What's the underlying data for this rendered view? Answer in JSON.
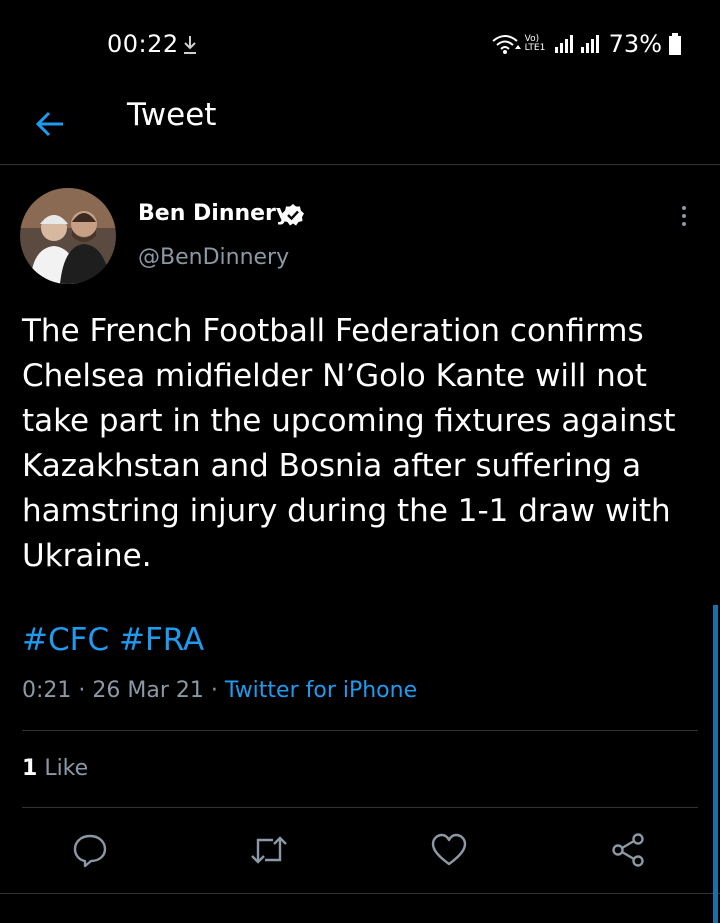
{
  "status_bar": {
    "time": "00:22",
    "network_label_top": "Vo)",
    "network_label_bottom": "LTE1",
    "battery": "73%",
    "icons": [
      "download-icon",
      "wifi-icon",
      "signal-icon",
      "signal-icon",
      "battery-icon"
    ]
  },
  "header": {
    "title": "Tweet",
    "back_icon": "arrow-left-icon"
  },
  "tweet": {
    "author_name": "Ben Dinnery",
    "author_handle": "@BenDinnery",
    "verified": true,
    "text": "The French Football Federation confirms Chelsea midfielder N’Golo Kante will not take part in the upcoming fixtures against Kazakhstan and Bosnia after suffering a hamstring injury during the 1-1 draw with Ukraine.",
    "hashtags": [
      "#CFC",
      "#FRA"
    ],
    "time": "0:21",
    "date": "26 Mar 21",
    "separator": "·",
    "source": "Twitter for iPhone",
    "like_count": "1",
    "like_label": "Like"
  },
  "actions": [
    {
      "name": "reply-icon"
    },
    {
      "name": "retweet-icon"
    },
    {
      "name": "like-icon"
    },
    {
      "name": "share-icon"
    }
  ],
  "colors": {
    "background": "#000000",
    "accent": "#1d9bf0",
    "secondary_text": "#8b98a5",
    "divider": "#2f3336"
  }
}
